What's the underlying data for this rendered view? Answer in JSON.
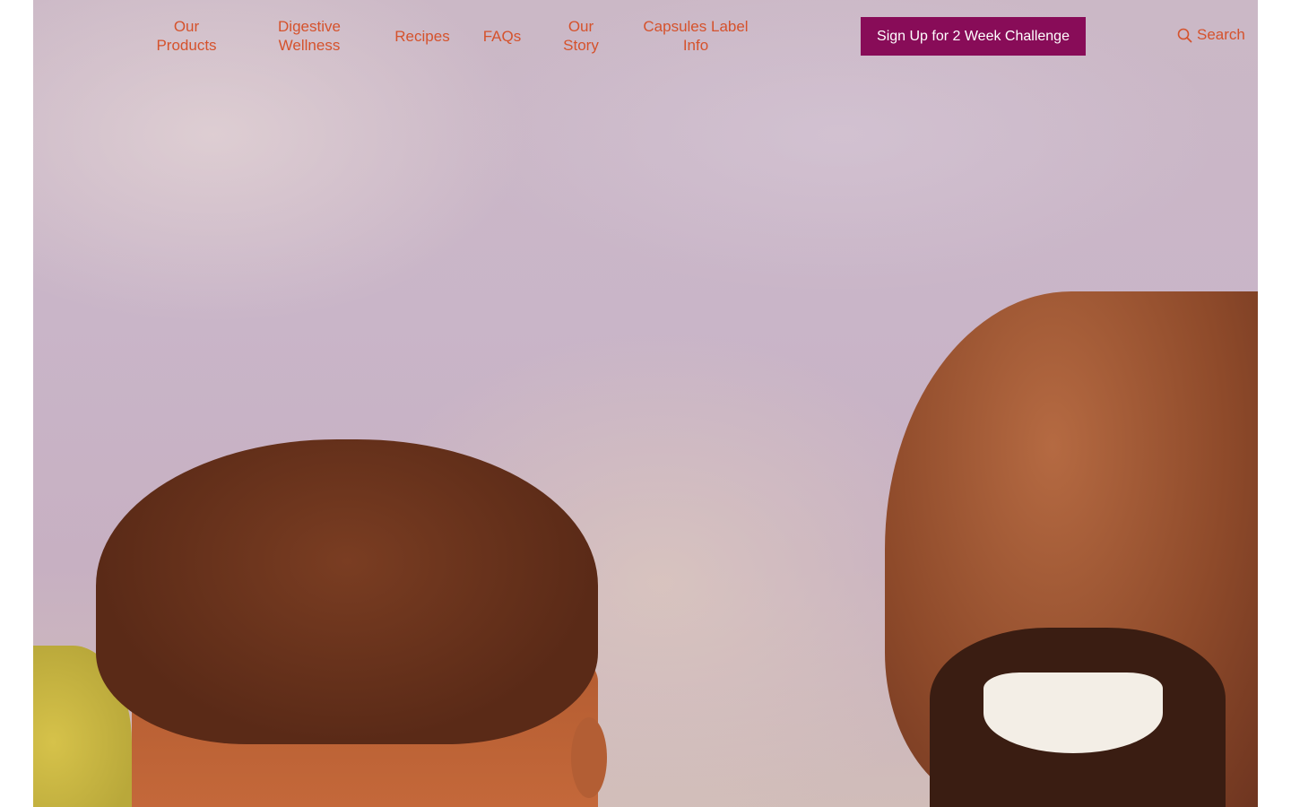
{
  "nav": {
    "items": [
      {
        "line1": "Our",
        "line2": "Products"
      },
      {
        "line1": "Digestive",
        "line2": "Wellness"
      },
      {
        "line1": "Recipes"
      },
      {
        "line1": "FAQs"
      },
      {
        "line1": "Our",
        "line2": "Story"
      },
      {
        "line1": "Capsules Label",
        "line2": "Info"
      }
    ],
    "cta_label": "Sign Up for 2 Week Challenge",
    "search_label": "Search",
    "search_icon": "search-icon"
  },
  "colors": {
    "nav_text": "#d5522c",
    "cta_bg": "#880c58",
    "cta_text": "#ffffff"
  }
}
